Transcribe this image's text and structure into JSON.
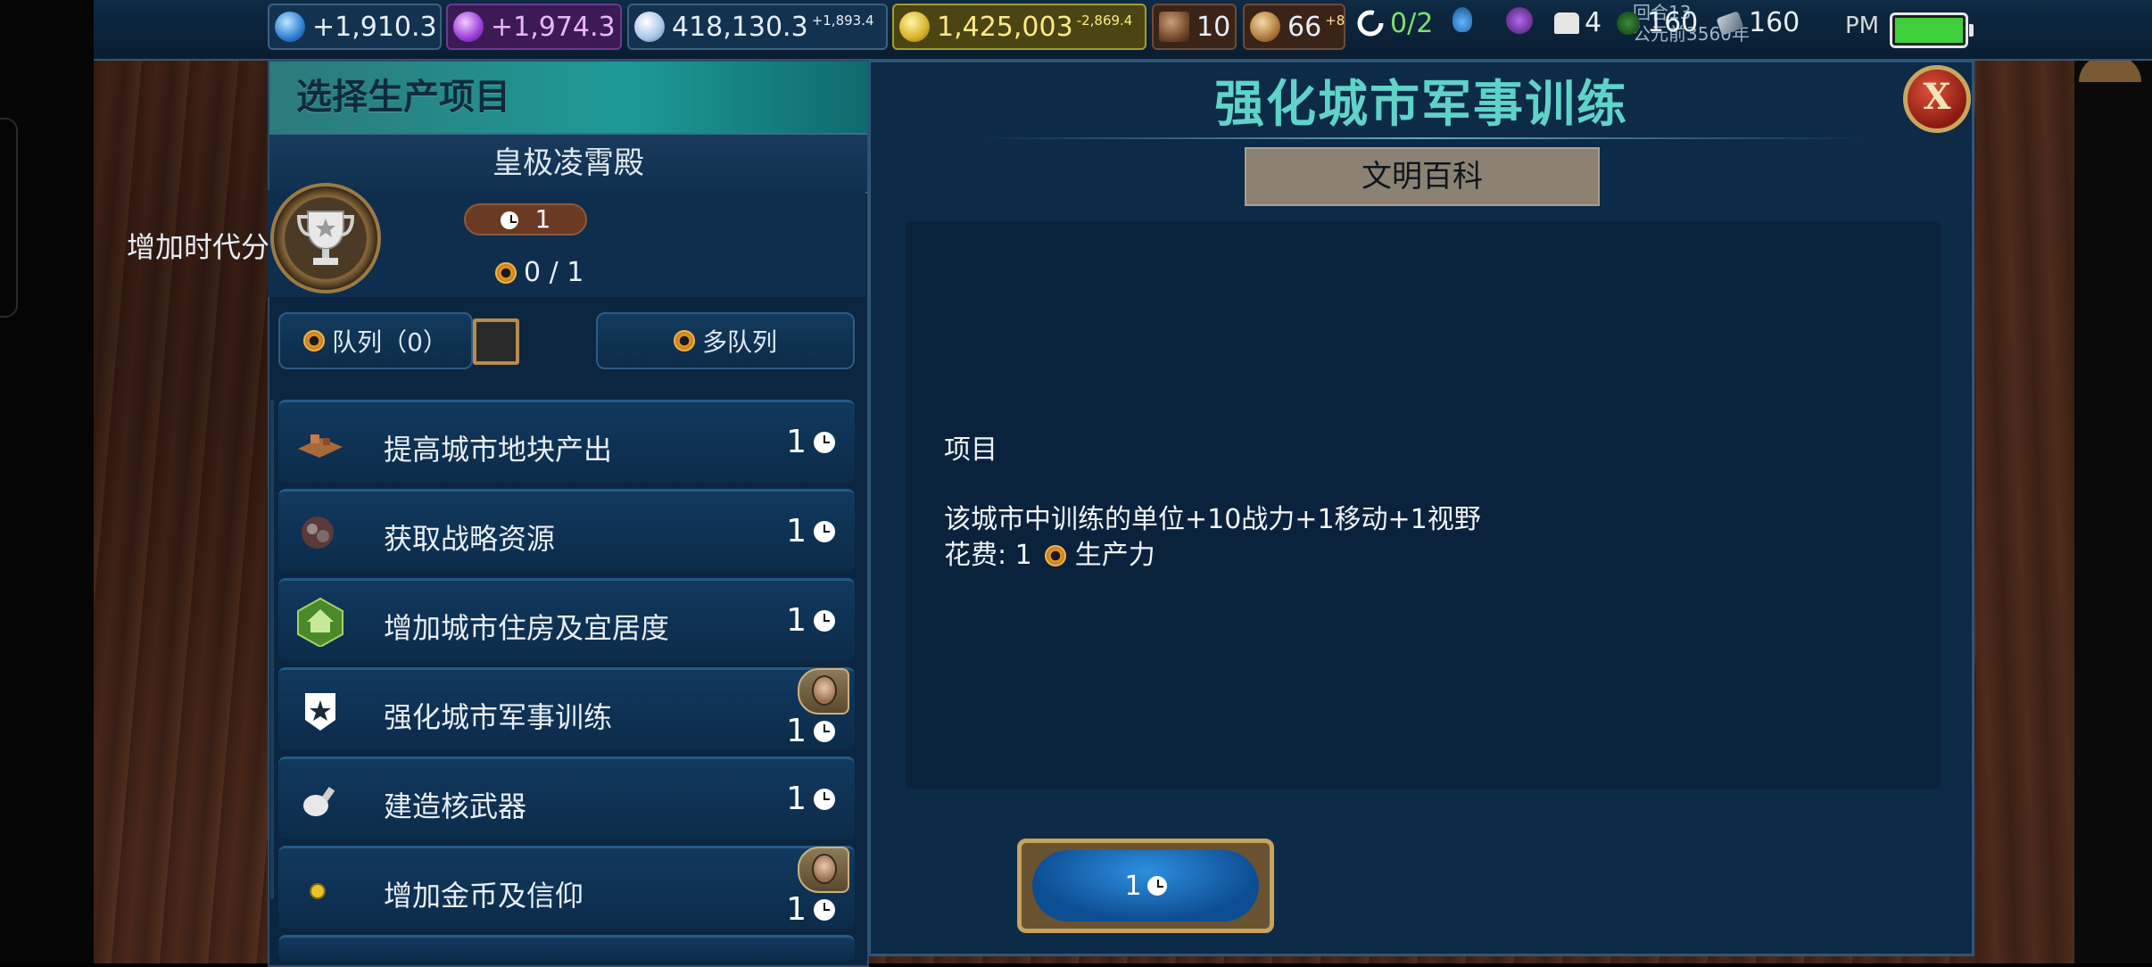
{
  "resources": {
    "science": "+1,910.3",
    "culture": "+1,974.3",
    "faith": "418,130.3",
    "faith_delta": "+1,893.4",
    "gold": "1,425,003",
    "gold_delta": "-2,869.4",
    "trade": "10",
    "tourism": "66",
    "tourism_delta": "+8",
    "governor": "0/2",
    "units": "4",
    "strategic_1": "160",
    "strategic_2": "160",
    "turn_label": "回合13",
    "era_date": "公元前3560年",
    "clock": "PM"
  },
  "left_panel": {
    "title": "选择生产项目",
    "city_name": "皇极凌霄殿",
    "current": {
      "name": "增加时代分",
      "turns": "1",
      "progress": "0 / 1"
    },
    "queue_label": "队列（0）",
    "multi_queue_label": "多队列",
    "items": [
      {
        "name": "提高城市地块产出",
        "turns": "1",
        "icon": "tile-yield-icon",
        "has_advisor": false
      },
      {
        "name": "获取战略资源",
        "turns": "1",
        "icon": "strategic-resource-icon",
        "has_advisor": false
      },
      {
        "name": "增加城市住房及宜居度",
        "turns": "1",
        "icon": "housing-icon",
        "has_advisor": false
      },
      {
        "name": "强化城市军事训练",
        "turns": "1",
        "icon": "military-training-icon",
        "has_advisor": true
      },
      {
        "name": "建造核武器",
        "turns": "1",
        "icon": "nuclear-bomb-icon",
        "has_advisor": false
      },
      {
        "name": "增加金币及信仰",
        "turns": "1",
        "icon": "gold-coin-icon",
        "has_advisor": true
      }
    ]
  },
  "detail": {
    "title": "强化城市军事训练",
    "civilopedia_label": "文明百科",
    "category": "项目",
    "effect": "该城市中训练的单位+10战力+1移动+1视野",
    "cost_prefix": "花费: 1",
    "cost_suffix": "生产力",
    "purchase_turns": "1"
  },
  "colors": {
    "accent_teal": "#5fd3c9",
    "panel_blue": "#0d2a47",
    "gold_frame": "#c4a45e"
  }
}
